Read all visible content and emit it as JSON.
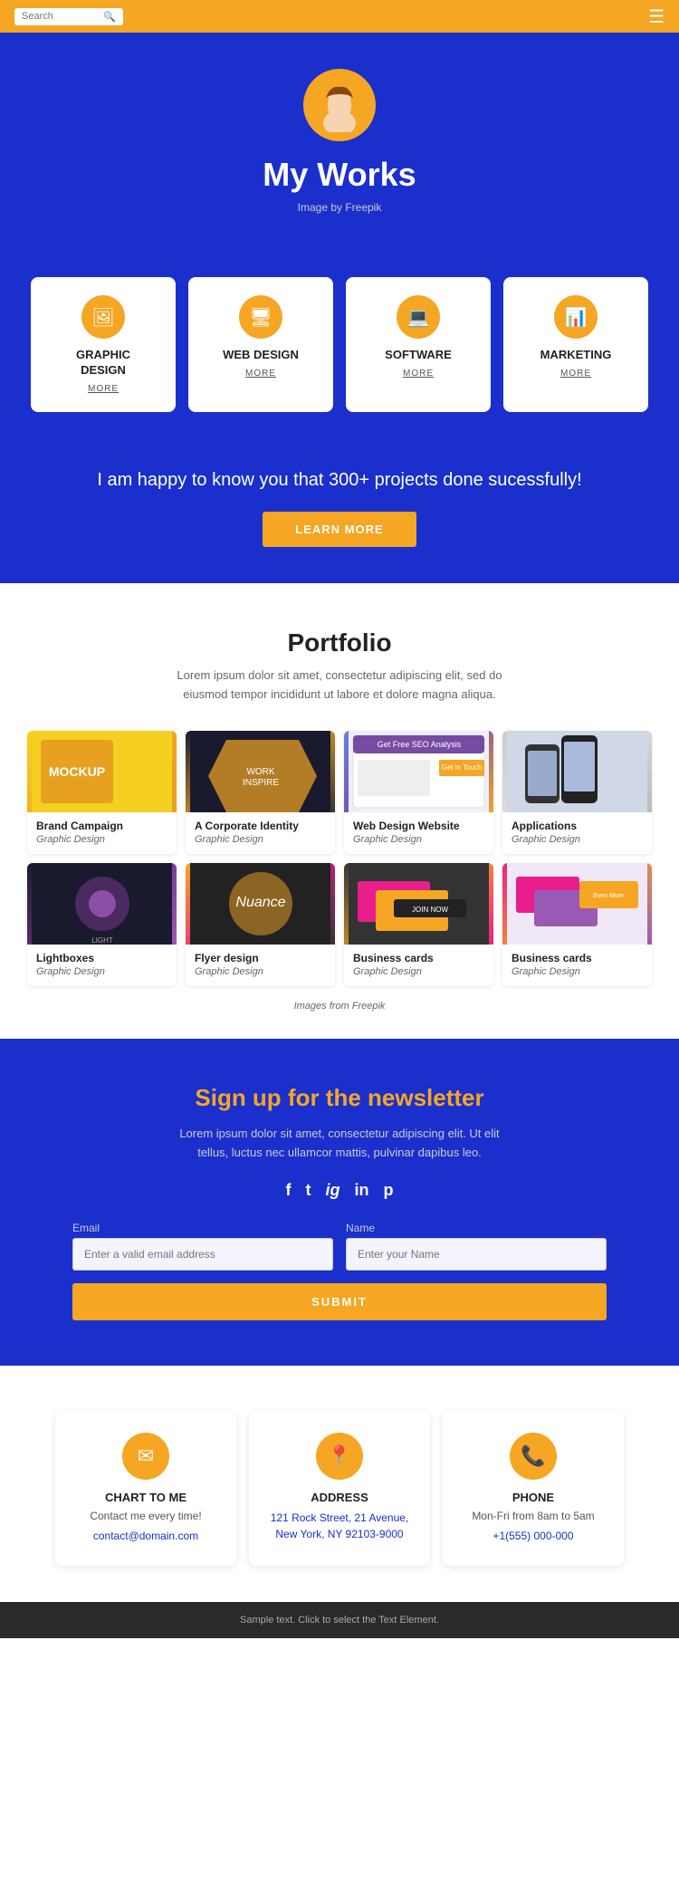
{
  "header": {
    "search_placeholder": "Search",
    "hamburger_label": "menu"
  },
  "hero": {
    "title": "My Works",
    "subtitle": "Image by Freepik"
  },
  "services": [
    {
      "id": "graphic-design",
      "title": "GRAPHIC\nDESIGN",
      "more": "MORE",
      "icon": "🖼"
    },
    {
      "id": "web-design",
      "title": "WEB DESIGN",
      "more": "MORE",
      "icon": "🖥"
    },
    {
      "id": "software",
      "title": "SOFTWARE",
      "more": "MORE",
      "icon": "💻"
    },
    {
      "id": "marketing",
      "title": "MARKETING",
      "more": "MORE",
      "icon": "📊"
    }
  ],
  "projects_cta": {
    "text": "I am happy to know you that 300+ projects done sucessfully!",
    "button": "LEARN MORE"
  },
  "portfolio": {
    "title": "Portfolio",
    "description": "Lorem ipsum dolor sit amet, consectetur adipiscing elit, sed do eiusmod tempor incididunt ut labore et dolore magna aliqua.",
    "items": [
      {
        "title": "Brand Campaign",
        "category": "Graphic Design",
        "img_class": "img-yellow"
      },
      {
        "title": "A Corporate Identity",
        "category": "Graphic Design",
        "img_class": "img-dark"
      },
      {
        "title": "Web Design Website",
        "category": "Graphic Design",
        "img_class": "img-seo"
      },
      {
        "title": "Applications",
        "category": "Graphic Design",
        "img_class": "img-phone"
      },
      {
        "title": "Lightboxes",
        "category": "Graphic Design",
        "img_class": "img-purple"
      },
      {
        "title": "Flyer design",
        "category": "Graphic Design",
        "img_class": "img-flyer"
      },
      {
        "title": "Business cards",
        "category": "Graphic Design",
        "img_class": "img-cards"
      },
      {
        "title": "Business cards",
        "category": "Graphic Design",
        "img_class": "img-cards2"
      }
    ],
    "credit": "Images from Freepik"
  },
  "newsletter": {
    "title": "Sign up for the newsletter",
    "description": "Lorem ipsum dolor sit amet, consectetur adipiscing elit. Ut elit tellus, luctus nec ullamcor mattis, pulvinar dapibus leo.",
    "social": [
      {
        "label": "f",
        "name": "facebook"
      },
      {
        "label": "t",
        "name": "twitter"
      },
      {
        "label": "ig",
        "name": "instagram"
      },
      {
        "label": "in",
        "name": "linkedin"
      },
      {
        "label": "p",
        "name": "pinterest"
      }
    ],
    "email_label": "Email",
    "email_placeholder": "Enter a valid email address",
    "name_label": "Name",
    "name_placeholder": "Enter your Name",
    "submit_label": "SUBMIT"
  },
  "contact": {
    "cards": [
      {
        "id": "chat",
        "icon": "✉",
        "title": "CHART TO ME",
        "desc": "Contact me every time!",
        "link": "contact@domain.com",
        "link_href": "mailto:contact@domain.com"
      },
      {
        "id": "address",
        "icon": "📍",
        "title": "ADDRESS",
        "desc": "",
        "link": "121 Rock Street, 21 Avenue,\nNew York, NY 92103-9000",
        "link_href": "#"
      },
      {
        "id": "phone",
        "icon": "📞",
        "title": "PHONE",
        "desc": "Mon-Fri from 8am to 5am",
        "link": "+1(555) 000-000",
        "link_href": "tel:+15550000000"
      }
    ]
  },
  "footer": {
    "text": "Sample text. Click to select the Text Element."
  }
}
